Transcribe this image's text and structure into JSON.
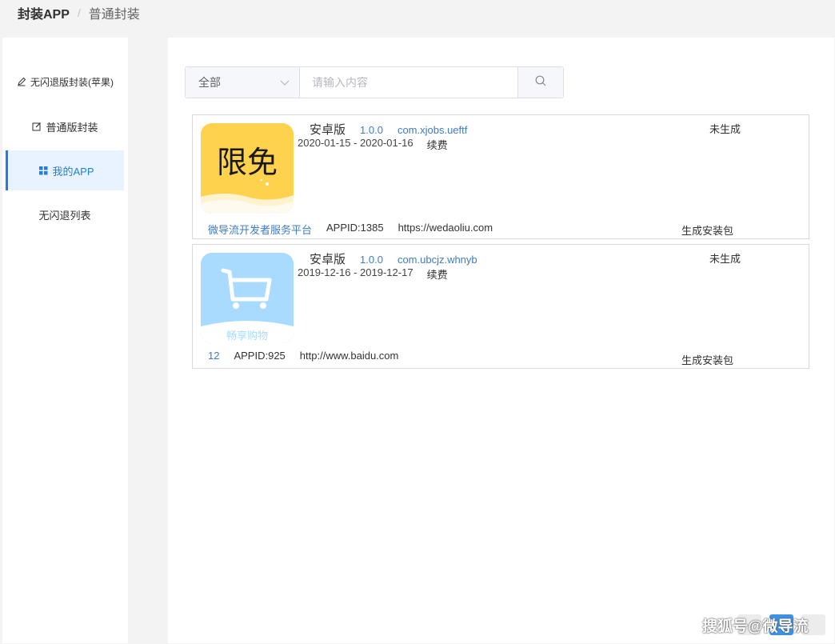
{
  "breadcrumb": {
    "root": "封装APP",
    "separator": "/",
    "current": "普通封装"
  },
  "sidebar": {
    "items": [
      {
        "label": "无闪退版封装(苹果)",
        "icon": "pen-icon",
        "active": false
      },
      {
        "label": "普通版封装",
        "icon": "edit-icon",
        "active": false
      },
      {
        "label": "我的APP",
        "icon": "grid-icon",
        "active": true
      },
      {
        "label": "无闪退列表",
        "icon": "",
        "active": false
      }
    ]
  },
  "search": {
    "select_value": "全部",
    "placeholder": "请输入内容",
    "icon": "search-icon"
  },
  "apps": [
    {
      "icon_text": "限免",
      "icon_color": "#ffd24d",
      "platform": "安卓版",
      "version": "1.0.0",
      "package": "com.xjobs.ueftf",
      "date_range": "2020-01-15 - 2020-01-16",
      "renew": "续费",
      "status": "未生成",
      "developer": "微导流开发者服务平台",
      "appid": "APPID:1385",
      "url": "https://wedaoliu.com",
      "action": "生成安装包"
    },
    {
      "icon_text": "畅享购物",
      "icon_color": "#a8dbff",
      "platform": "安卓版",
      "version": "1.0.0",
      "package": "com.ubcjz.whnyb",
      "date_range": "2019-12-16 - 2019-12-17",
      "renew": "续费",
      "status": "未生成",
      "developer": "12",
      "appid": "APPID:925",
      "url": "http://www.baidu.com",
      "action": "生成安装包"
    }
  ],
  "watermark": {
    "text": "搜狐号@微导流"
  },
  "colors": {
    "accent": "#1f7fdc",
    "link": "#3f7cc4",
    "active_bg": "#e8f3ff"
  }
}
